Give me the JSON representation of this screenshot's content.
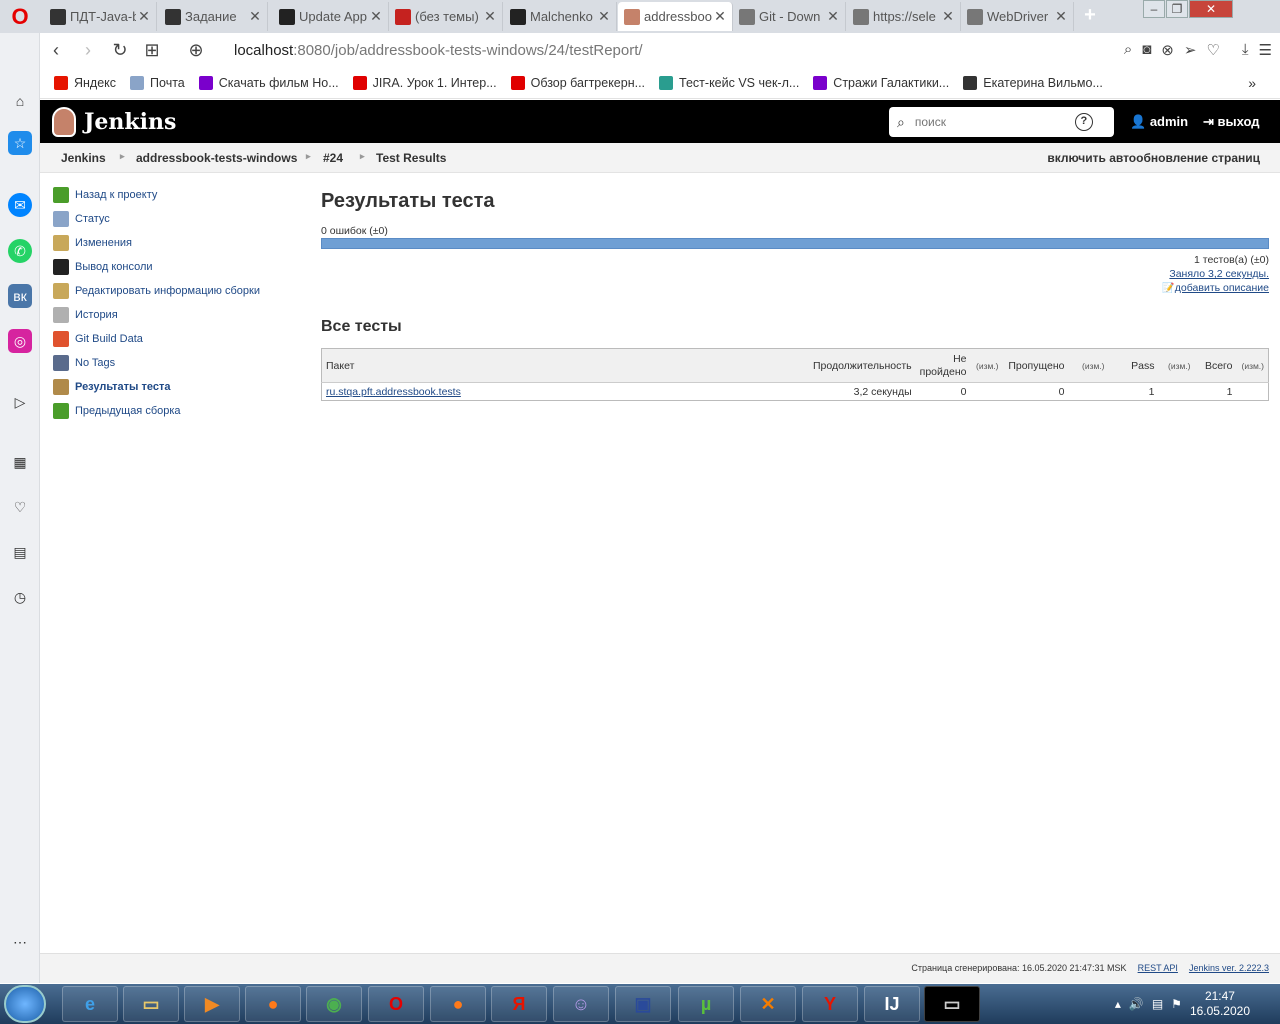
{
  "browser": {
    "tabs": [
      {
        "label": "ПДТ-Java-b",
        "icon": "m-icon",
        "color": "#333333"
      },
      {
        "label": "Задание",
        "icon": "m-icon",
        "color": "#333333"
      },
      {
        "label": "Update App",
        "icon": "github-icon",
        "color": "#222222"
      },
      {
        "label": "(без темы)",
        "icon": "gmail-icon",
        "color": "#c5221f"
      },
      {
        "label": "Malchenko",
        "icon": "github-icon",
        "color": "#222222"
      },
      {
        "label": "addressboo",
        "icon": "jenkins-icon",
        "color": "#c5826a"
      },
      {
        "label": "Git - Down",
        "icon": "page-icon",
        "color": "#777777"
      },
      {
        "label": "https://sele",
        "icon": "page-icon",
        "color": "#777777"
      },
      {
        "label": "WebDriver",
        "icon": "page-icon",
        "color": "#777777"
      }
    ],
    "url_host": "localhost",
    "url_rest": ":8080/job/addressbook-tests-windows/24/testReport/",
    "bookmarks": [
      {
        "label": "Яндекс",
        "color": "#e61400"
      },
      {
        "label": "Почта",
        "color": "#8aa4c8"
      },
      {
        "label": "Скачать фильм Но...",
        "color": "#7a00cc"
      },
      {
        "label": "JIRA. Урок 1. Интер...",
        "color": "#e00000"
      },
      {
        "label": "Обзор багтрекерн...",
        "color": "#e00000"
      },
      {
        "label": "Тест-кейс VS чек-л...",
        "color": "#2a9d8f"
      },
      {
        "label": "Стражи Галактики...",
        "color": "#7a00cc"
      },
      {
        "label": "Екатерина Вильмо...",
        "color": "#333333"
      }
    ]
  },
  "jenkins": {
    "logo": "Jenkins",
    "search_placeholder": "поиск",
    "user": "admin",
    "logout": "выход",
    "breadcrumbs": [
      "Jenkins",
      "addressbook-tests-windows",
      "#24",
      "Test Results"
    ],
    "auto_refresh": "включить автообновление страниц",
    "tasks": [
      {
        "label": "Назад к проекту",
        "icon": "up-arrow-icon",
        "color": "#4a9d2a"
      },
      {
        "label": "Статус",
        "icon": "magnifier-icon",
        "color": "#8aa4c8"
      },
      {
        "label": "Изменения",
        "icon": "notepad-icon",
        "color": "#c8a85a"
      },
      {
        "label": "Вывод консоли",
        "icon": "terminal-icon",
        "color": "#222222"
      },
      {
        "label": "Редактировать информацию сборки",
        "icon": "notepad-icon",
        "color": "#c8a85a"
      },
      {
        "label": "История",
        "icon": "notepad-icon",
        "color": "#b0b0b0"
      },
      {
        "label": "Git Build Data",
        "icon": "git-icon",
        "color": "#e0522e"
      },
      {
        "label": "No Tags",
        "icon": "floppy-icon",
        "color": "#5a6b8c"
      },
      {
        "label": "Результаты теста",
        "icon": "clipboard-icon",
        "color": "#b08a4a"
      },
      {
        "label": "Предыдущая сборка",
        "icon": "left-arrow-icon",
        "color": "#4a9d2a"
      }
    ],
    "title": "Результаты теста",
    "fail_summary": "0 ошибок (±0)",
    "tests_count": "1 тестов(а) (±0)",
    "took": "Заняло 3,2 секунды.",
    "add_description": "добавить описание",
    "all_tests_title": "Все тесты",
    "table": {
      "headers": {
        "package": "Пакет",
        "duration": "Продолжительность",
        "failed": "Не пройдено",
        "failed_diff": "(изм.)",
        "skipped": "Пропущено",
        "skipped_diff": "(изм.)",
        "pass": "Pass",
        "pass_diff": "(изм.)",
        "total": "Всего",
        "total_diff": "(изм.)"
      },
      "rows": [
        {
          "package": "ru.stqa.pft.addressbook.tests",
          "duration": "3,2 секунды",
          "failed": "0",
          "skipped": "0",
          "pass": "1",
          "total": "1"
        }
      ]
    },
    "footer": {
      "generated": "Страница сгенерирована: 16.05.2020 21:47:31 MSK",
      "rest_api": "REST API",
      "version": "Jenkins ver. 2.222.3"
    }
  },
  "taskbar": {
    "time": "21:47",
    "date": "16.05.2020"
  }
}
